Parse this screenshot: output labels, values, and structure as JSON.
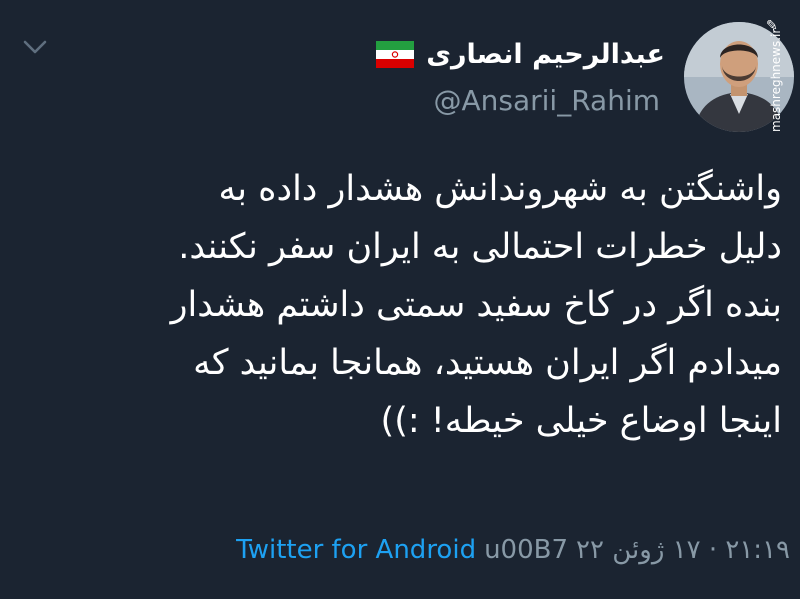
{
  "tweet": {
    "display_name": "عبدالرحیم انصاری",
    "handle": "@Ansarii_Rahim",
    "lines": [
      "واشنگتن به شهروندانش هشدار داده به",
      "دلیل خطرات احتمالی به ایران سفر نکنند.",
      "بنده اگر در کاخ سفید سمتی داشتم هشدار",
      "میدادم اگر ایران هستید، همانجا بمانید که",
      "اینجا اوضاع خیلی خیطه! :))"
    ],
    "timestamp": "۲۱:۱۹ · ۱۷ ژوئن ۲۲",
    "separator": "u00B7",
    "client": "Twitter for Android"
  },
  "watermark": "mashreghnews.ir",
  "icons": {
    "menu": "chevron-down-icon",
    "flag": "iran-flag-icon"
  },
  "colors": {
    "background": "#1b2431",
    "text": "#ffffff",
    "secondary": "#8899a6",
    "link": "#1da1f2"
  }
}
